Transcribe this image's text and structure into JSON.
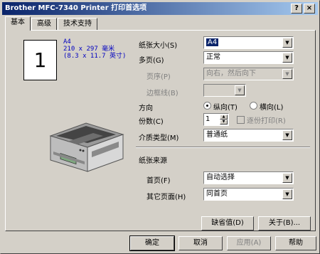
{
  "window": {
    "title": "Brother MFC-7340 Printer 打印首选项",
    "help_btn": "?",
    "close_btn": "×"
  },
  "tabs": [
    {
      "label": "基本",
      "active": true
    },
    {
      "label": "高级",
      "active": false
    },
    {
      "label": "技术支持",
      "active": false
    }
  ],
  "preview": {
    "copies_number": "1",
    "paper_name": "A4",
    "paper_mm": "210 x 297 毫米",
    "paper_in": "(8.3 x 11.7 英寸)"
  },
  "settings": {
    "paper_size": {
      "label": "纸张大小(S)",
      "value": "A4"
    },
    "multiple_page": {
      "label": "多页(G)",
      "value": "正常"
    },
    "page_order": {
      "label": "页序(P)",
      "value": "向右，然后向下"
    },
    "border_line": {
      "label": "边框线(B)",
      "value": ""
    },
    "orientation": {
      "label": "方向",
      "portrait": "纵向(T)",
      "landscape": "横向(L)",
      "selected": "portrait"
    },
    "copies": {
      "label": "份数(C)",
      "value": "1",
      "collate_label": "逐份打印(R)",
      "collate_checked": false
    },
    "media_type": {
      "label": "介质类型(M)",
      "value": "普通纸"
    }
  },
  "paper_source": {
    "group_label": "纸张来源",
    "first_page": {
      "label": "首页(F)",
      "value": "自动选择"
    },
    "other_pages": {
      "label": "其它页面(H)",
      "value": "同首页"
    }
  },
  "buttons": {
    "default": "缺省值(D)",
    "about": "关于(B)...",
    "ok": "确定",
    "cancel": "取消",
    "apply": "应用(A)",
    "help": "帮助"
  }
}
